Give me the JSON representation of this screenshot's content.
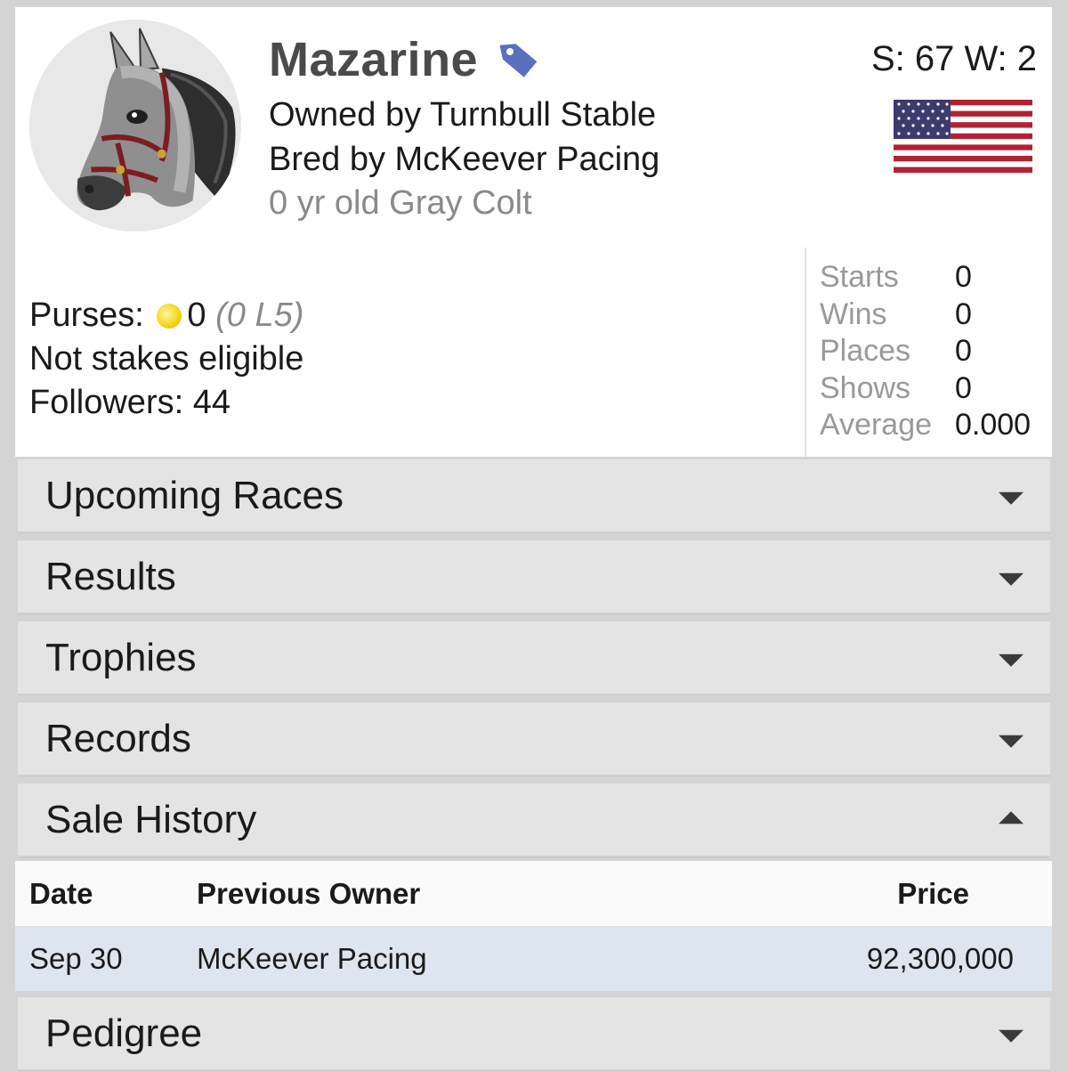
{
  "horse": {
    "name": "Mazarine",
    "owned_by": "Owned by Turnbull Stable",
    "bred_by": "Bred by McKeever Pacing",
    "description": "0 yr old Gray Colt",
    "sw": "S: 67 W: 2"
  },
  "stats": {
    "purses_label": "Purses:",
    "purses_value": "0",
    "purses_l5": "(0 L5)",
    "stakes": "Not stakes eligible",
    "followers": "Followers: 44"
  },
  "record": [
    {
      "label": "Starts",
      "value": "0"
    },
    {
      "label": "Wins",
      "value": "0"
    },
    {
      "label": "Places",
      "value": "0"
    },
    {
      "label": "Shows",
      "value": "0"
    },
    {
      "label": "Average",
      "value": "0.000"
    }
  ],
  "sections": {
    "upcoming": "Upcoming Races",
    "results": "Results",
    "trophies": "Trophies",
    "records": "Records",
    "sale_history": "Sale History",
    "pedigree": "Pedigree"
  },
  "sale_history": {
    "headers": {
      "date": "Date",
      "owner": "Previous Owner",
      "price": "Price"
    },
    "rows": [
      {
        "date": "Sep 30",
        "owner": "McKeever Pacing",
        "price": "92,300,000"
      }
    ]
  },
  "icons": {
    "tag": "tag-icon",
    "flag": "us-flag-icon",
    "coin": "coin-icon"
  },
  "colors": {
    "tag": "#5b6fbf",
    "row_highlight": "#dde5f0",
    "section_bg": "#e4e4e4"
  }
}
